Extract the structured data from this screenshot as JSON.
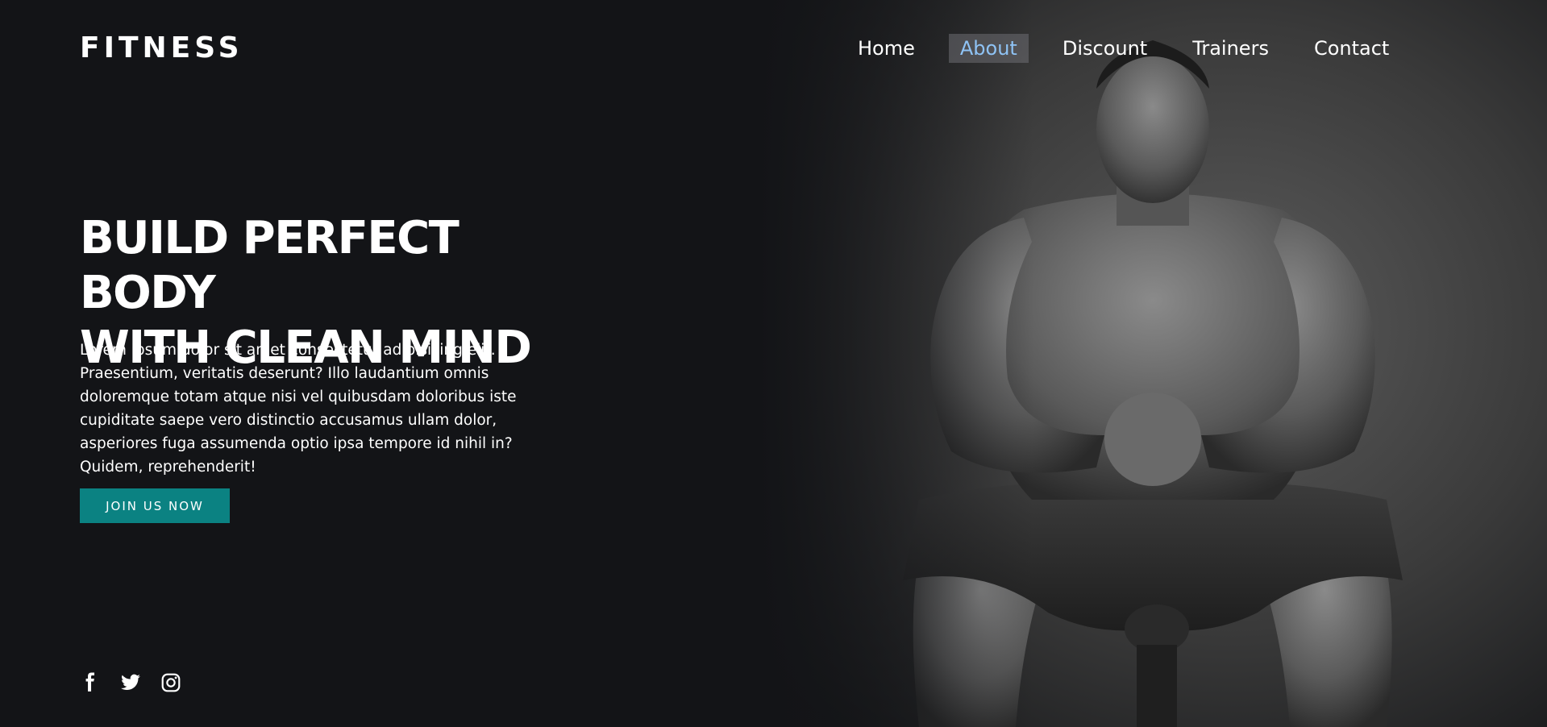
{
  "brand": {
    "logo_text": "FITNESS"
  },
  "nav": {
    "items": [
      {
        "label": "Home",
        "active": false
      },
      {
        "label": "About",
        "active": true
      },
      {
        "label": "Discount",
        "active": false
      },
      {
        "label": "Trainers",
        "active": false
      },
      {
        "label": "Contact",
        "active": false
      }
    ]
  },
  "hero": {
    "headline_line1": "BUILD PERFECT BODY",
    "headline_line2": "WITH CLEAN MIND",
    "description": "Lorem ipsum dolor sit amet consectetur adipisicing elit. Praesentium, veritatis deserunt? Illo laudantium omnis doloremque totam atque nisi vel quibusdam doloribus iste cupiditate saepe vero distinctio accusamus ullam dolor, asperiores fuga assumenda optio ipsa tempore id nihil in? Quidem, reprehenderit!",
    "cta_label": "JOIN US NOW"
  },
  "social": {
    "icons": [
      "facebook-icon",
      "twitter-icon",
      "instagram-icon"
    ]
  },
  "colors": {
    "background": "#131417",
    "accent": "#0b8282",
    "active_nav_text": "#8fc3f5",
    "text": "#ffffff"
  }
}
